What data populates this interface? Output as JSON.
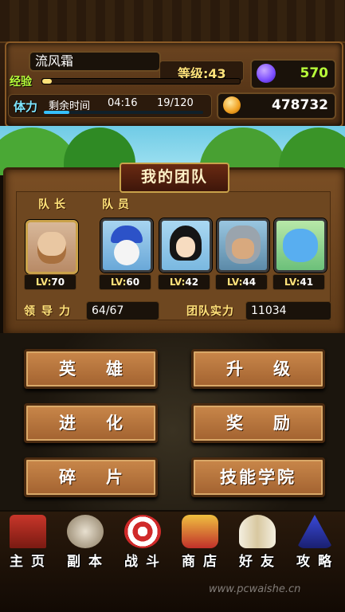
{
  "player": {
    "name": "流风霜",
    "level_label": "等级:43",
    "exp_label": "经验",
    "stamina_label": "体力",
    "remaining_label": "剩余时间",
    "timer": "04:16",
    "stamina_value": "19/120",
    "exp_fraction": 0.05,
    "stamina_fraction": 0.16
  },
  "currency": {
    "gems": "570",
    "coins": "478732"
  },
  "team": {
    "title": "我的团队",
    "leader_label": "队长",
    "members_label": "队员",
    "leader": {
      "level": "70",
      "icon": "leader-portrait"
    },
    "members": [
      {
        "level": "60",
        "icon": "blue-hat-hero-portrait"
      },
      {
        "level": "42",
        "icon": "black-hair-hero-portrait"
      },
      {
        "level": "44",
        "icon": "gray-hair-warrior-portrait"
      },
      {
        "level": "41",
        "icon": "blue-creature-portrait"
      }
    ],
    "lv_prefix": "LV:",
    "leadership_label": "领导力",
    "leadership_value": "64/67",
    "power_label": "团队实力",
    "power_value": "11034"
  },
  "menu": [
    "英雄",
    "升级",
    "进化",
    "奖励",
    "碎片",
    "技能学院"
  ],
  "nav": [
    {
      "label": "主页",
      "icon": "home-icon"
    },
    {
      "label": "副本",
      "icon": "skull-icon"
    },
    {
      "label": "战斗",
      "icon": "target-icon"
    },
    {
      "label": "商店",
      "icon": "shop-icon"
    },
    {
      "label": "好友",
      "icon": "wings-icon"
    },
    {
      "label": "攻略",
      "icon": "wizard-hat-icon"
    }
  ],
  "watermark": "www.pcwaishe.cn",
  "colors": {
    "gem": "#7a4cff",
    "coin": "#f0a020",
    "accent": "#b8ff3a"
  }
}
